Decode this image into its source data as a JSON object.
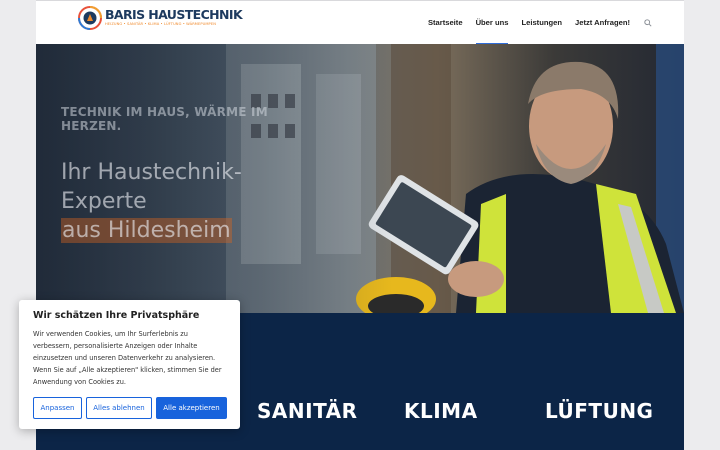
{
  "logo": {
    "title": "BARIS HAUSTECHNIK",
    "subtitle": "HEIZUNG • SANITÄR • KLIMA • LÜFTUNG • WÄRMEPUMPEN"
  },
  "nav": {
    "items": [
      {
        "label": "Startseite",
        "active": false
      },
      {
        "label": "Über uns",
        "active": true
      },
      {
        "label": "Leistungen",
        "active": false
      },
      {
        "label": "Jetzt Anfragen!",
        "active": false
      }
    ],
    "search_icon": "search-icon"
  },
  "hero": {
    "tagline": "TECHNIK IM HAUS, WÄRME IM HERZEN.",
    "headline_line1": "Ihr Haustechnik-",
    "headline_line2": "Experte",
    "headline_highlight": "aus Hildesheim"
  },
  "services": {
    "items": [
      "SANITÄR",
      "KLIMA",
      "LÜFTUNG"
    ]
  },
  "cookie": {
    "title": "Wir schätzen Ihre Privatsphäre",
    "text": "Wir verwenden Cookies, um Ihr Surferlebnis zu verbessern, personalisierte Anzeigen oder Inhalte einzusetzen und unseren Datenverkehr zu analysieren. Wenn Sie auf „Alle akzeptieren\" klicken, stimmen Sie der Anwendung von Cookies zu.",
    "btn_customize": "Anpassen",
    "btn_reject": "Alles ablehnen",
    "btn_accept": "Alle akzeptieren"
  },
  "colors": {
    "brand_navy": "#0c2547",
    "accent_blue": "#1863dc",
    "nav_active": "#2f6cd8",
    "logo_orange": "#f0892a"
  }
}
